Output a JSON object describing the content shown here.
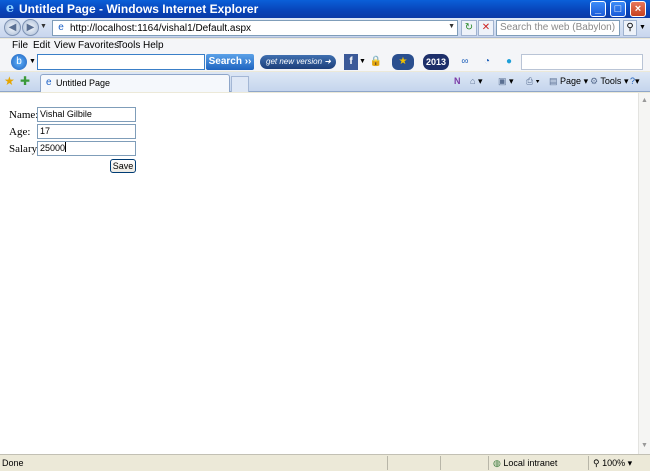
{
  "window": {
    "title": "Untitled Page - Windows Internet Explorer",
    "buttons": {
      "minimize": "_",
      "maximize": "□",
      "close": "×"
    }
  },
  "address_bar": {
    "url": "http://localhost:1164/vishal1/Default.aspx",
    "search_placeholder": "Search the web (Babylon)"
  },
  "menu": {
    "items": [
      "File",
      "Edit",
      "View",
      "Favorites",
      "Tools",
      "Help"
    ]
  },
  "babylon_toolbar": {
    "search_button": "Search",
    "get_new_version": "get new version",
    "year_badge": "2013"
  },
  "tabs": {
    "active_tab": "Untitled Page"
  },
  "command_bar": {
    "page": "Page",
    "tools": "Tools"
  },
  "form": {
    "name_label": "Name:",
    "name_value": "Vishal Gilbile",
    "age_label": "Age:",
    "age_value": "17",
    "salary_label": "Salary:",
    "salary_value": "25000",
    "save_label": "Save"
  },
  "status_bar": {
    "status": "Done",
    "zone": "Local intranet",
    "zoom": "100%"
  }
}
